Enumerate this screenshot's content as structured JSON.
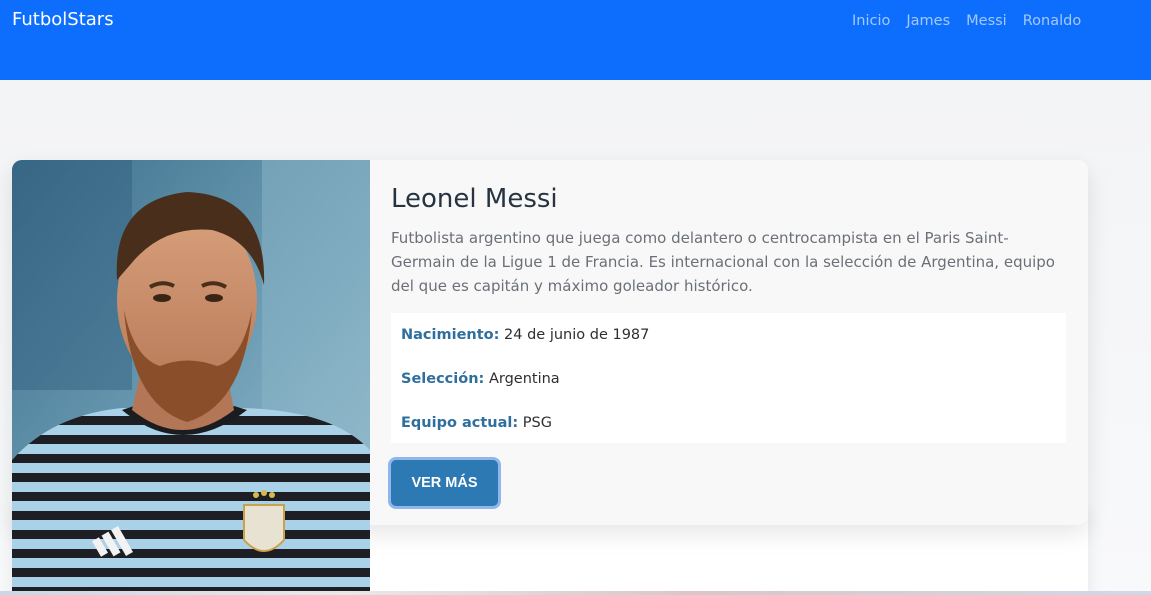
{
  "navbar": {
    "brand": "FutbolStars",
    "links": [
      "Inicio",
      "James",
      "Messi",
      "Ronaldo"
    ],
    "background": "#0d6efd"
  },
  "card": {
    "image_description": "player-photo",
    "title": "Leonel Messi",
    "description": "Futbolista argentino que juega como delantero o centrocampista en el Paris Saint-Germain de la Ligue 1 de Francia. Es internacional con la selección de Argentina, equipo del que es capitán y máximo goleador histórico.",
    "details": [
      {
        "label": "Nacimiento:",
        "value": "24 de junio de 1987"
      },
      {
        "label": "Selección:",
        "value": "Argentina"
      },
      {
        "label": "Equipo actual:",
        "value": "PSG"
      }
    ],
    "button_label": "VER MÁS",
    "accent": "#2c79b4"
  }
}
